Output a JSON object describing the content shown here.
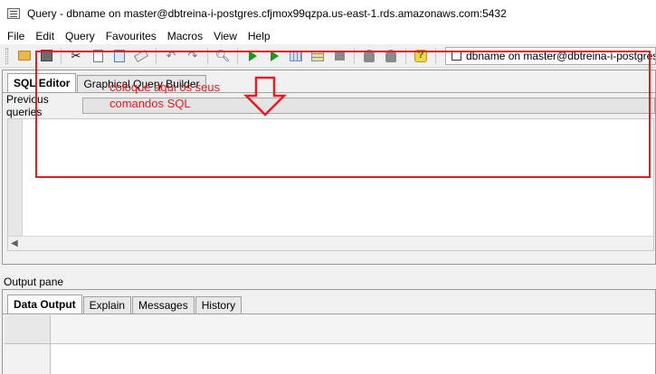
{
  "window": {
    "title": "Query - dbname on master@dbtreina-i-postgres.cfjmox99qzpa.us-east-1.rds.amazonaws.com:5432"
  },
  "menu": {
    "items": [
      "File",
      "Edit",
      "Query",
      "Favourites",
      "Macros",
      "View",
      "Help"
    ]
  },
  "toolbar": {
    "connection_label": "dbname on master@dbtreina-i-postgres.cfjmo",
    "icons": [
      "open-icon",
      "save-icon",
      "cut-icon",
      "copy-icon",
      "paste-icon",
      "clear-icon",
      "undo-icon",
      "redo-icon",
      "find-icon",
      "execute-icon",
      "explain-icon",
      "execute-to-file-icon",
      "explain-analyze-icon",
      "cancel-icon",
      "user-icon",
      "user-group-icon",
      "help-icon"
    ]
  },
  "editor_tabs": [
    {
      "label": "SQL Editor",
      "active": true
    },
    {
      "label": "Graphical Query Builder",
      "active": false
    }
  ],
  "previous_queries": {
    "label": "Previous queries",
    "value": ""
  },
  "annotation": {
    "line1": "coloque aqui os seus",
    "line2": "comandos SQL",
    "color": "#e31c25"
  },
  "output": {
    "label": "Output pane",
    "tabs": [
      {
        "label": "Data Output",
        "active": true
      },
      {
        "label": "Explain",
        "active": false
      },
      {
        "label": "Messages",
        "active": false
      },
      {
        "label": "History",
        "active": false
      }
    ]
  }
}
